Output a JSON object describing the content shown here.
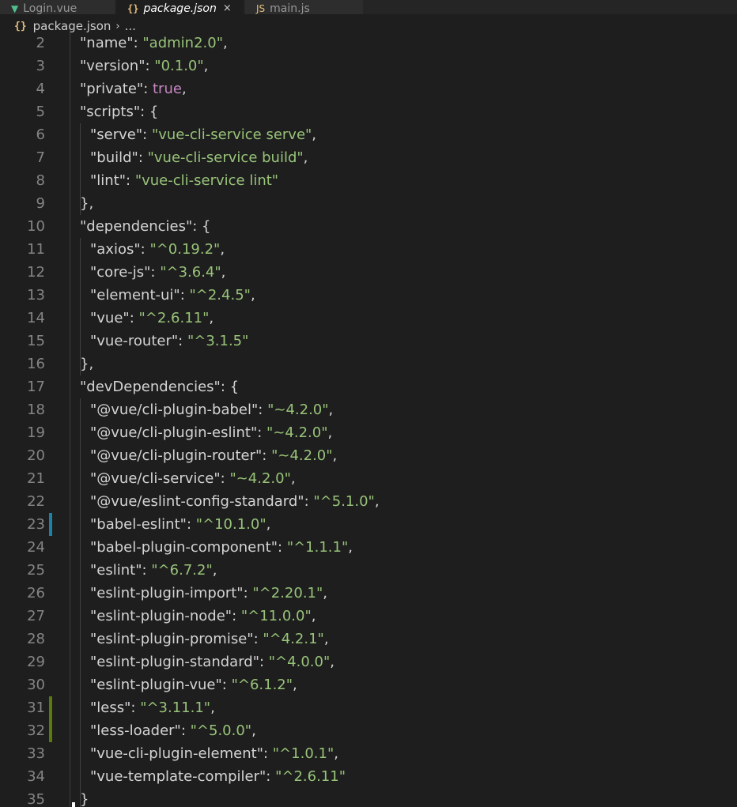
{
  "tabs": [
    {
      "label": "Login.vue",
      "icon": "vue-icon",
      "active": false
    },
    {
      "label": "package.json",
      "icon": "json-icon",
      "active": true,
      "close": "×"
    },
    {
      "label": "main.js",
      "icon": "js-icon",
      "active": false
    }
  ],
  "breadcrumb": {
    "file": "package.json",
    "separator": "›",
    "more": "..."
  },
  "colors": {
    "editor_bg": "#1e1e1e",
    "string": "#98c379",
    "boolean": "#c586c0",
    "line_number": "#858585",
    "modified_gutter": "#1b81a8",
    "added_gutter": "#587c0c"
  },
  "lines": [
    {
      "n": "2",
      "key": "\"name\"",
      "sep": ": ",
      "val": "\"admin2.0\"",
      "vtype": "s",
      "tail": ",",
      "indent": 1
    },
    {
      "n": "3",
      "key": "\"version\"",
      "sep": ": ",
      "val": "\"0.1.0\"",
      "vtype": "s",
      "tail": ",",
      "indent": 1
    },
    {
      "n": "4",
      "key": "\"private\"",
      "sep": ": ",
      "val": "true",
      "vtype": "b",
      "tail": ",",
      "indent": 1
    },
    {
      "n": "5",
      "key": "\"scripts\"",
      "sep": ": ",
      "val": "",
      "vtype": "p",
      "tail": "{",
      "indent": 1
    },
    {
      "n": "6",
      "key": "\"serve\"",
      "sep": ": ",
      "val": "\"vue-cli-service serve\"",
      "vtype": "s",
      "tail": ",",
      "indent": 2
    },
    {
      "n": "7",
      "key": "\"build\"",
      "sep": ": ",
      "val": "\"vue-cli-service build\"",
      "vtype": "s",
      "tail": ",",
      "indent": 2
    },
    {
      "n": "8",
      "key": "\"lint\"",
      "sep": ": ",
      "val": "\"vue-cli-service lint\"",
      "vtype": "s",
      "tail": "",
      "indent": 2
    },
    {
      "n": "9",
      "key": "",
      "sep": "",
      "val": "",
      "vtype": "p",
      "tail": "},",
      "indent": 1
    },
    {
      "n": "10",
      "key": "\"dependencies\"",
      "sep": ": ",
      "val": "",
      "vtype": "p",
      "tail": "{",
      "indent": 1
    },
    {
      "n": "11",
      "key": "\"axios\"",
      "sep": ": ",
      "val": "\"^0.19.2\"",
      "vtype": "s",
      "tail": ",",
      "indent": 2
    },
    {
      "n": "12",
      "key": "\"core-js\"",
      "sep": ": ",
      "val": "\"^3.6.4\"",
      "vtype": "s",
      "tail": ",",
      "indent": 2
    },
    {
      "n": "13",
      "key": "\"element-ui\"",
      "sep": ": ",
      "val": "\"^2.4.5\"",
      "vtype": "s",
      "tail": ",",
      "indent": 2
    },
    {
      "n": "14",
      "key": "\"vue\"",
      "sep": ": ",
      "val": "\"^2.6.11\"",
      "vtype": "s",
      "tail": ",",
      "indent": 2
    },
    {
      "n": "15",
      "key": "\"vue-router\"",
      "sep": ": ",
      "val": "\"^3.1.5\"",
      "vtype": "s",
      "tail": "",
      "indent": 2
    },
    {
      "n": "16",
      "key": "",
      "sep": "",
      "val": "",
      "vtype": "p",
      "tail": "},",
      "indent": 1
    },
    {
      "n": "17",
      "key": "\"devDependencies\"",
      "sep": ": ",
      "val": "",
      "vtype": "p",
      "tail": "{",
      "indent": 1
    },
    {
      "n": "18",
      "key": "\"@vue/cli-plugin-babel\"",
      "sep": ": ",
      "val": "\"~4.2.0\"",
      "vtype": "s",
      "tail": ",",
      "indent": 2
    },
    {
      "n": "19",
      "key": "\"@vue/cli-plugin-eslint\"",
      "sep": ": ",
      "val": "\"~4.2.0\"",
      "vtype": "s",
      "tail": ",",
      "indent": 2
    },
    {
      "n": "20",
      "key": "\"@vue/cli-plugin-router\"",
      "sep": ": ",
      "val": "\"~4.2.0\"",
      "vtype": "s",
      "tail": ",",
      "indent": 2
    },
    {
      "n": "21",
      "key": "\"@vue/cli-service\"",
      "sep": ": ",
      "val": "\"~4.2.0\"",
      "vtype": "s",
      "tail": ",",
      "indent": 2
    },
    {
      "n": "22",
      "key": "\"@vue/eslint-config-standard\"",
      "sep": ": ",
      "val": "\"^5.1.0\"",
      "vtype": "s",
      "tail": ",",
      "indent": 2
    },
    {
      "n": "23",
      "key": "\"babel-eslint\"",
      "sep": ": ",
      "val": "\"^10.1.0\"",
      "vtype": "s",
      "tail": ",",
      "indent": 2,
      "gutter": "modified"
    },
    {
      "n": "24",
      "key": "\"babel-plugin-component\"",
      "sep": ": ",
      "val": "\"^1.1.1\"",
      "vtype": "s",
      "tail": ",",
      "indent": 2
    },
    {
      "n": "25",
      "key": "\"eslint\"",
      "sep": ": ",
      "val": "\"^6.7.2\"",
      "vtype": "s",
      "tail": ",",
      "indent": 2
    },
    {
      "n": "26",
      "key": "\"eslint-plugin-import\"",
      "sep": ": ",
      "val": "\"^2.20.1\"",
      "vtype": "s",
      "tail": ",",
      "indent": 2
    },
    {
      "n": "27",
      "key": "\"eslint-plugin-node\"",
      "sep": ": ",
      "val": "\"^11.0.0\"",
      "vtype": "s",
      "tail": ",",
      "indent": 2
    },
    {
      "n": "28",
      "key": "\"eslint-plugin-promise\"",
      "sep": ": ",
      "val": "\"^4.2.1\"",
      "vtype": "s",
      "tail": ",",
      "indent": 2
    },
    {
      "n": "29",
      "key": "\"eslint-plugin-standard\"",
      "sep": ": ",
      "val": "\"^4.0.0\"",
      "vtype": "s",
      "tail": ",",
      "indent": 2
    },
    {
      "n": "30",
      "key": "\"eslint-plugin-vue\"",
      "sep": ": ",
      "val": "\"^6.1.2\"",
      "vtype": "s",
      "tail": ",",
      "indent": 2
    },
    {
      "n": "31",
      "key": "\"less\"",
      "sep": ": ",
      "val": "\"^3.11.1\"",
      "vtype": "s",
      "tail": ",",
      "indent": 2,
      "gutter": "added"
    },
    {
      "n": "32",
      "key": "\"less-loader\"",
      "sep": ": ",
      "val": "\"^5.0.0\"",
      "vtype": "s",
      "tail": ",",
      "indent": 2,
      "gutter": "added"
    },
    {
      "n": "33",
      "key": "\"vue-cli-plugin-element\"",
      "sep": ": ",
      "val": "\"^1.0.1\"",
      "vtype": "s",
      "tail": ",",
      "indent": 2
    },
    {
      "n": "34",
      "key": "\"vue-template-compiler\"",
      "sep": ": ",
      "val": "\"^2.6.11\"",
      "vtype": "s",
      "tail": "",
      "indent": 2
    },
    {
      "n": "35",
      "key": "",
      "sep": "",
      "val": "",
      "vtype": "p",
      "tail": "}",
      "indent": 1
    }
  ]
}
